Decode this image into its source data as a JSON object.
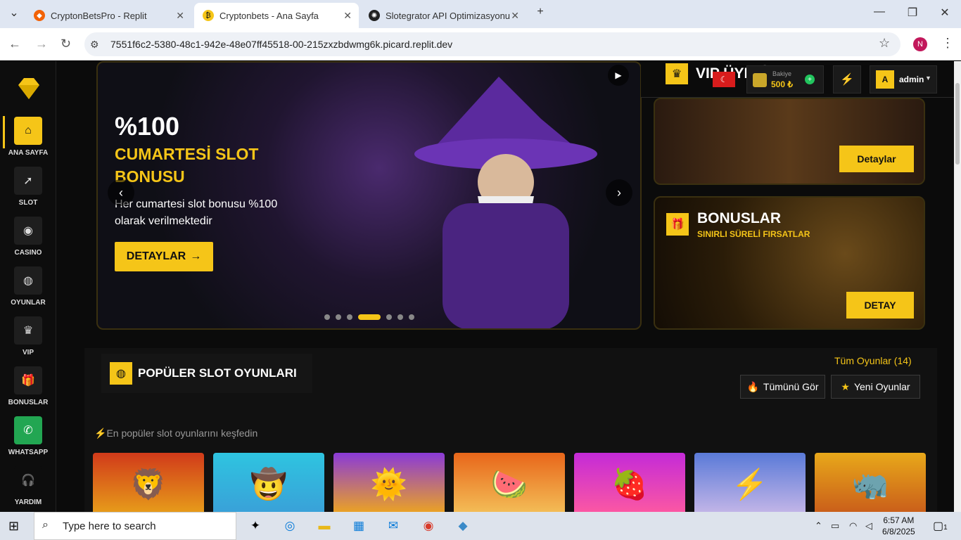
{
  "browser": {
    "tabs": [
      {
        "title": "CryptonBetsPro - Replit"
      },
      {
        "title": "Cryptonbets - Ana Sayfa"
      },
      {
        "title": "Slotegrator API Optimizasyonu"
      }
    ],
    "url": "7551f6c2-5380-48c1-942e-48e07ff45518-00-215zxzbdwmg6k.picard.replit.dev",
    "profile_initial": "N"
  },
  "sidebar": {
    "items": [
      {
        "label": "ANA SAYFA",
        "icon": "home-icon"
      },
      {
        "label": "SLOT",
        "icon": "rocket-icon"
      },
      {
        "label": "CASINO",
        "icon": "chips-icon"
      },
      {
        "label": "OYUNLAR",
        "icon": "gamepad-icon"
      },
      {
        "label": "VIP",
        "icon": "crown-icon"
      },
      {
        "label": "BONUSLAR",
        "icon": "gift-icon"
      },
      {
        "label": "WHATSAPP",
        "icon": "whatsapp-icon"
      },
      {
        "label": "YARDIM",
        "icon": "headset-icon"
      }
    ]
  },
  "hero": {
    "title": "%100",
    "subtitle": "CUMARTESİ SLOT BONUSU",
    "description": "Her cumartesi slot bonusu %100 olarak verilmektedir",
    "button_label": "DETAYLAR",
    "slide_count": 7,
    "active_slide": 4
  },
  "topbar": {
    "vip_label": "VIP ÜYELİK",
    "balance_label": "Bakiye",
    "balance_amount": "500 ₺",
    "username": "admin",
    "user_initial": "A"
  },
  "promos": {
    "vip_button": "Detaylar",
    "bonus_title": "BONUSLAR",
    "bonus_subtitle": "SINIRLI SÜRELİ FIRSATLAR",
    "bonus_button": "DETAY"
  },
  "popular": {
    "title": "POPÜLER SLOT OYUNLARI",
    "all_games": "Tüm Oyunlar (14)",
    "show_all": "Tümünü Gör",
    "new_games": "Yeni Oyunlar",
    "description": "En popüler slot oyunlarını keşfedin"
  },
  "taskbar": {
    "search_placeholder": "Type here to search",
    "time": "6:57 AM",
    "date": "6/8/2025",
    "notification_count": "1"
  }
}
